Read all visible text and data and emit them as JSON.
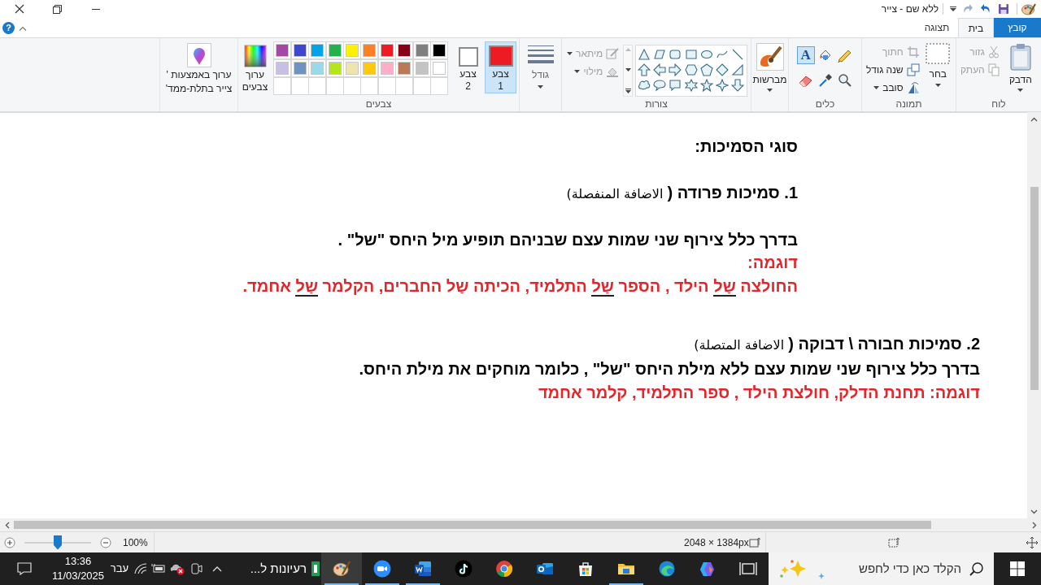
{
  "title_bar": {
    "title": "ללא שם - צייר"
  },
  "tabs": [
    {
      "label": "קובץ",
      "kind": "file",
      "selected": false
    },
    {
      "label": "בית",
      "kind": "tab",
      "selected": true
    },
    {
      "label": "תצוגה",
      "kind": "tab",
      "selected": false
    }
  ],
  "help": "?",
  "clipboard": {
    "label": "לוח",
    "paste": "הדבק",
    "actions": [
      {
        "kind": "cut",
        "label": "גזור",
        "disabled": true
      },
      {
        "kind": "copy",
        "label": "העתק",
        "disabled": true
      }
    ]
  },
  "image": {
    "label": "תמונה",
    "select": "בחר",
    "actions": [
      {
        "kind": "crop",
        "label": "חתוך",
        "disabled": true
      },
      {
        "kind": "resize",
        "label": "שנה גודל",
        "disabled": false
      },
      {
        "kind": "rotate",
        "label": "סובב",
        "disabled": false
      }
    ]
  },
  "tools": {
    "label": "כלים",
    "items": [
      {
        "kind": "pencil",
        "selected": false
      },
      {
        "kind": "fill",
        "selected": false
      },
      {
        "kind": "text",
        "glyph": "A",
        "selected": true
      },
      {
        "kind": "magnifier",
        "selected": false
      },
      {
        "kind": "picker",
        "selected": false
      },
      {
        "kind": "eraser",
        "selected": false
      }
    ]
  },
  "brushes": {
    "label": "מברשות"
  },
  "shapes": {
    "label": "צורות",
    "options": [
      {
        "kind": "outline",
        "label": "מיתאר",
        "disabled": true
      },
      {
        "kind": "fill",
        "label": "מילוי",
        "disabled": true
      }
    ]
  },
  "size": {
    "label": "גודל"
  },
  "colors": {
    "label": "צבעים",
    "slots": [
      {
        "label": "צבע 1",
        "color": "#ed1c24",
        "selected": true
      },
      {
        "label": "צבע 2",
        "color": "#ffffff",
        "selected": false
      }
    ],
    "palette": [
      {
        "color": "#000000"
      },
      {
        "color": "#7f7f7f"
      },
      {
        "color": "#880015"
      },
      {
        "color": "#ed1c24"
      },
      {
        "color": "#ff7f27"
      },
      {
        "color": "#fff200"
      },
      {
        "color": "#22b14c"
      },
      {
        "color": "#00a2e8"
      },
      {
        "color": "#3f48cc"
      },
      {
        "color": "#a349a4"
      },
      {
        "color": "#ffffff"
      },
      {
        "color": "#c3c3c3"
      },
      {
        "color": "#b97a57"
      },
      {
        "color": "#ffaec9"
      },
      {
        "color": "#ffc90e"
      },
      {
        "color": "#efe4b0"
      },
      {
        "color": "#b5e61d"
      },
      {
        "color": "#99d9ea"
      },
      {
        "color": "#7092be"
      },
      {
        "color": "#c8bfe7"
      },
      {
        "kind": "empty"
      },
      {
        "kind": "empty"
      },
      {
        "kind": "empty"
      },
      {
        "kind": "empty"
      },
      {
        "kind": "empty"
      },
      {
        "kind": "empty"
      },
      {
        "kind": "empty"
      },
      {
        "kind": "empty"
      },
      {
        "kind": "empty"
      },
      {
        "kind": "empty"
      }
    ],
    "edit": "ערוך צבעים"
  },
  "paint3d": {
    "lines": [
      "ערוך באמצעות '",
      "צייר בתלת-ממד'"
    ]
  },
  "canvas": {
    "blocks": [
      {
        "lines": [
          {
            "text": "סוגי הסמיכות:",
            "color": "#000000"
          },
          {
            "text": "1. סמיכות פרודה (",
            "note": "الاضافة المنفصلة)",
            "color": "#000000"
          },
          {
            "text": "בדרך כלל צירוף שני שמות עצם שבניהם תופיע מיל היחס \"של\" .",
            "color": "#000000"
          },
          {
            "text": "דוגמה:",
            "color": "#e3262b"
          },
          {
            "segments": [
              {
                "text": "החולצה ",
                "underlined": false
              },
              {
                "text": "שַל",
                "underlined": true
              },
              {
                "text": " הילד , הספר ",
                "underlined": false
              },
              {
                "text": "שַל",
                "underlined": true
              },
              {
                "text": " התלמיד, הכיתה ",
                "underlined": false
              },
              {
                "text": "שַל",
                "underlined": false
              },
              {
                "text": " החברים, הקלמר ",
                "underlined": false
              },
              {
                "text": "שַל",
                "underlined": true
              },
              {
                "text": " אחמד.",
                "underlined": false
              }
            ],
            "color": "#e3262b"
          }
        ]
      },
      {
        "lines": [
          {
            "text": "2. סמיכות חבורה \\ דבוקה (",
            "note": "الاضافة المتصلة)",
            "color": "#000000"
          },
          {
            "text": "בדרך כלל צירוף שני שמות עצם ללא מילת היחס \"של\" , כלומר מוחקים את מילת היחס.",
            "color": "#000000"
          },
          {
            "text": "דוגמה: תחנת הדלק, חולצת הילד , ספר התלמיד, קלמר אחמד",
            "color": "#e3262b"
          }
        ]
      }
    ]
  },
  "status_bar": {
    "zoom": {
      "level": 0.5,
      "reading": "100%"
    },
    "image_size": "2048 × 1384px"
  },
  "taskbar": {
    "search": {
      "placeholder": "הקלד כאן כדי לחפש"
    },
    "apps": [
      {
        "kind": "taskview",
        "running": false,
        "selected": false
      },
      {
        "kind": "copilot",
        "running": false,
        "selected": false
      },
      {
        "kind": "edge",
        "running": false,
        "selected": false
      },
      {
        "kind": "explorer",
        "running": true,
        "selected": false
      },
      {
        "kind": "store",
        "running": false,
        "selected": false
      },
      {
        "kind": "outlook",
        "running": false,
        "selected": false
      },
      {
        "kind": "chrome",
        "running": false,
        "selected": false
      },
      {
        "kind": "tiktok",
        "running": false,
        "selected": false
      },
      {
        "kind": "word",
        "running": true,
        "selected": false
      },
      {
        "kind": "zoom",
        "running": true,
        "selected": false
      },
      {
        "kind": "paint",
        "running": true,
        "selected": true
      }
    ],
    "window_label": "רעיונות ל...",
    "language": "עבר",
    "time": "13:36",
    "date": "11/03/2025"
  }
}
